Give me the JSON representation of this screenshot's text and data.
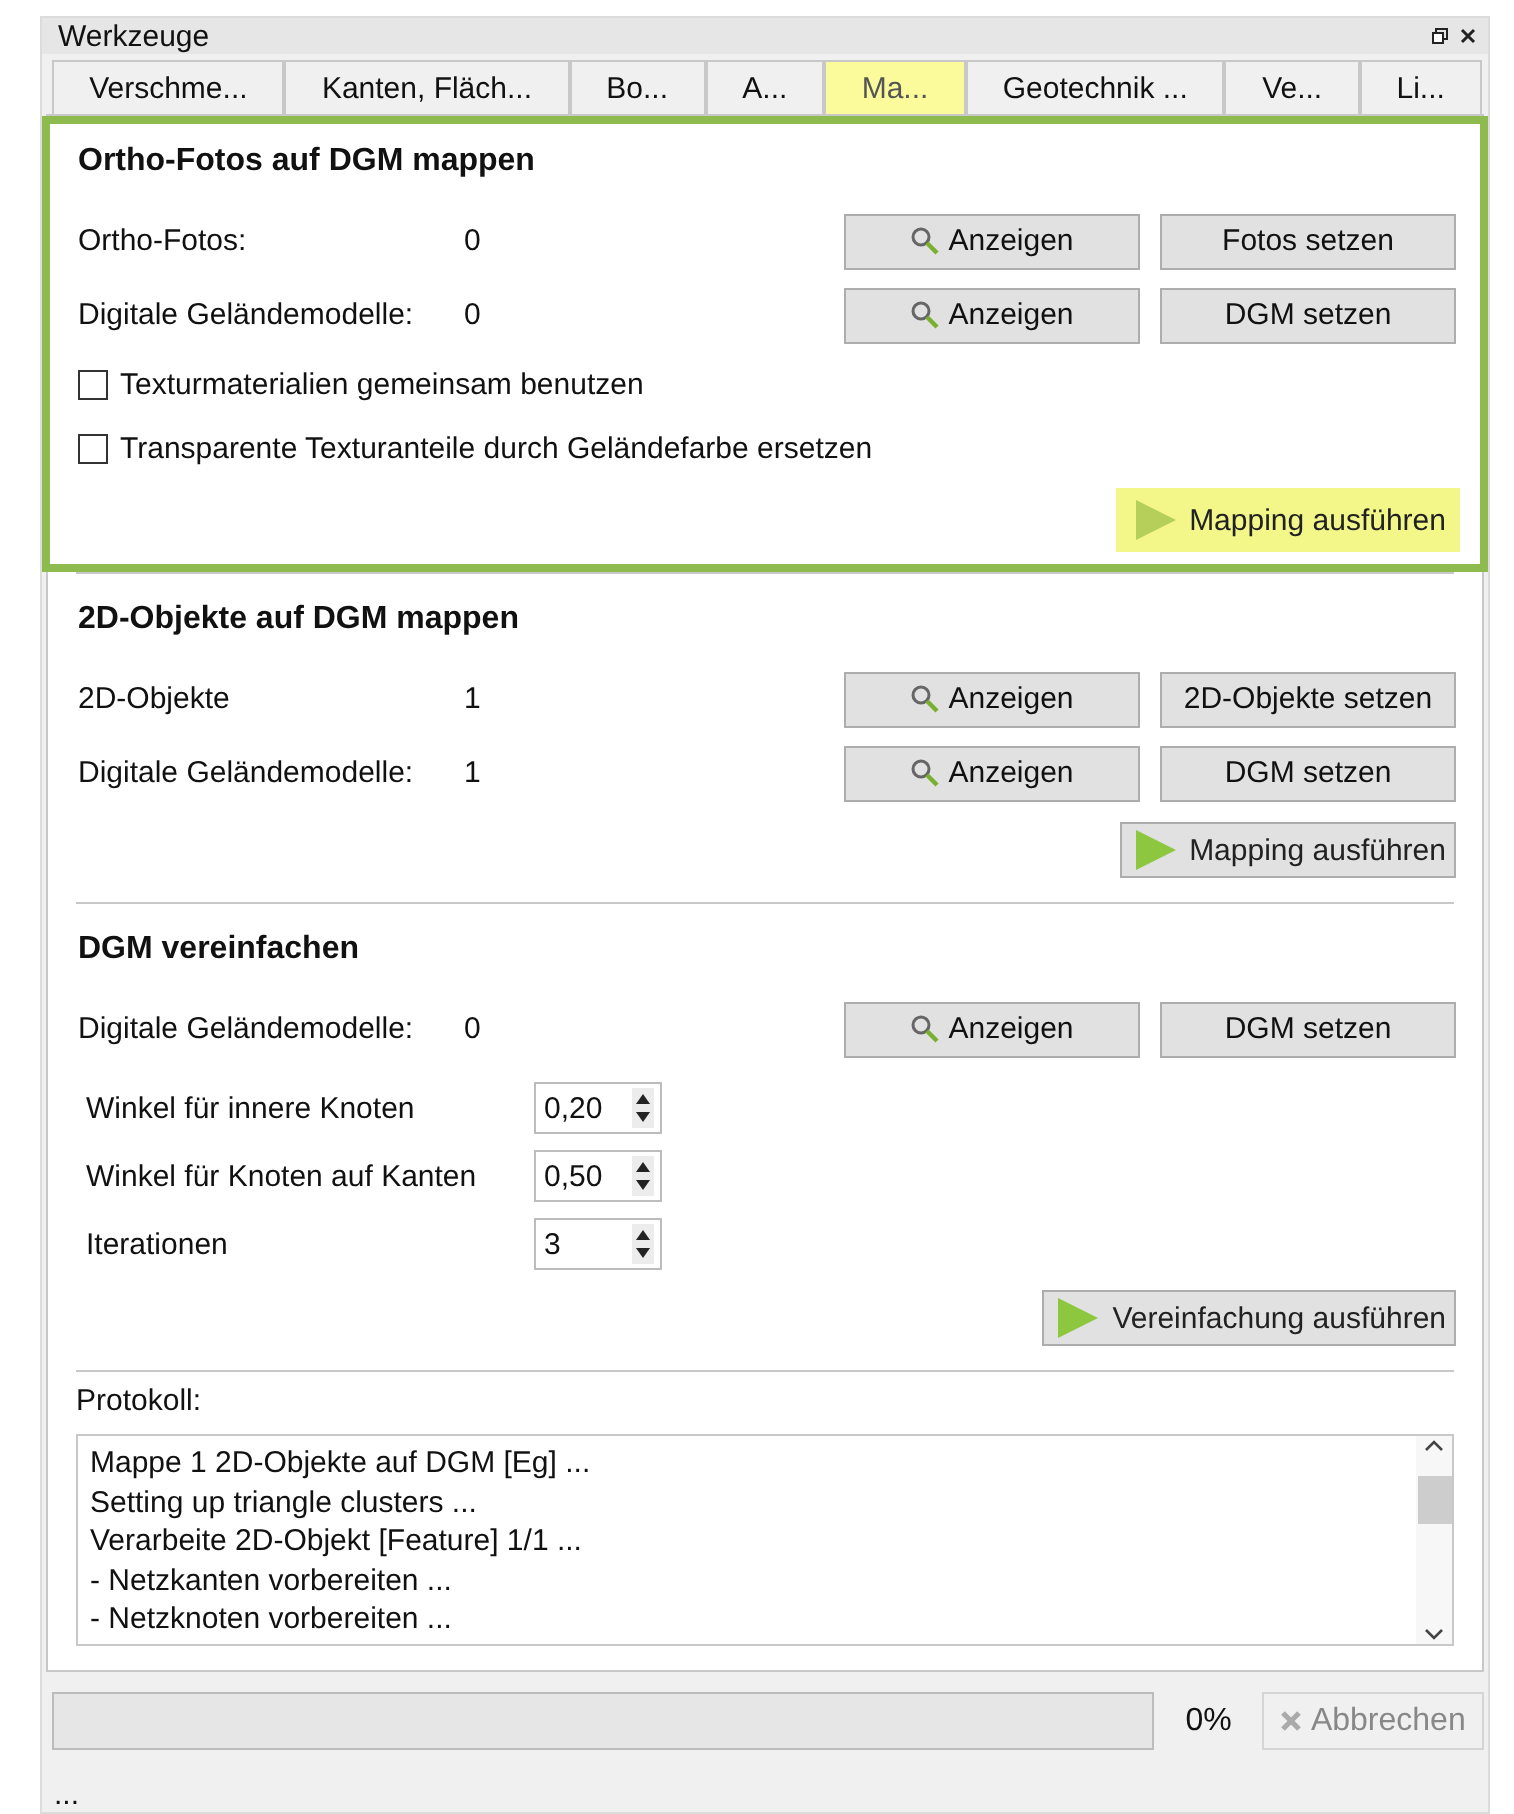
{
  "window": {
    "title": "Werkzeuge"
  },
  "tabs": [
    {
      "label": "Verschme...",
      "selected": false
    },
    {
      "label": "Kanten, Fläch...",
      "selected": false
    },
    {
      "label": "Bo...",
      "selected": false
    },
    {
      "label": "A...",
      "selected": false
    },
    {
      "label": "Ma...",
      "selected": true
    },
    {
      "label": "Geotechnik ...",
      "selected": false
    },
    {
      "label": "Ve...",
      "selected": false
    },
    {
      "label": "Li...",
      "selected": false
    }
  ],
  "sections": [
    {
      "title": "Ortho-Fotos auf DGM mappen",
      "highlighted": true,
      "rows": [
        {
          "label": "Ortho-Fotos:",
          "value": "0",
          "show_button": "Anzeigen",
          "set_button": "Fotos setzen"
        },
        {
          "label": "Digitale Geländemodelle:",
          "value": "0",
          "show_button": "Anzeigen",
          "set_button": "DGM setzen"
        }
      ],
      "checkboxes": [
        {
          "label": "Texturmaterialien gemeinsam benutzen",
          "checked": false
        },
        {
          "label": "Transparente Texturanteile durch Geländefarbe ersetzen",
          "checked": false
        }
      ],
      "run_button": {
        "label": "Mapping ausführen",
        "highlighted": true
      }
    },
    {
      "title": "2D-Objekte auf DGM mappen",
      "rows": [
        {
          "label": "2D-Objekte",
          "value": "1",
          "show_button": "Anzeigen",
          "set_button": "2D-Objekte setzen"
        },
        {
          "label": "Digitale Geländemodelle:",
          "value": "1",
          "show_button": "Anzeigen",
          "set_button": "DGM setzen"
        }
      ],
      "run_button": {
        "label": "Mapping ausführen",
        "highlighted": false
      }
    },
    {
      "title": "DGM vereinfachen",
      "rows": [
        {
          "label": "Digitale Geländemodelle:",
          "value": "0",
          "show_button": "Anzeigen",
          "set_button": "DGM setzen"
        }
      ],
      "parameters": [
        {
          "label": "Winkel für innere Knoten",
          "value": "0,20"
        },
        {
          "label": "Winkel für Knoten auf Kanten",
          "value": "0,50"
        },
        {
          "label": "Iterationen",
          "value": "3"
        }
      ],
      "run_button": {
        "label": "Vereinfachung ausführen",
        "highlighted": false
      }
    }
  ],
  "log": {
    "label": "Protokoll:",
    "lines": [
      "Mappe 1 2D-Objekte auf DGM [Eg] ...",
      "Setting up triangle clusters ...",
      "Verarbeite 2D-Objekt [Feature] 1/1 ...",
      "- Netzkanten vorbereiten ...",
      "- Netzknoten vorbereiten ..."
    ]
  },
  "progress": {
    "level": 0,
    "reading": "0%"
  },
  "cancel_button": {
    "label": "Abbrechen",
    "disabled": true
  },
  "status_bar": "..."
}
